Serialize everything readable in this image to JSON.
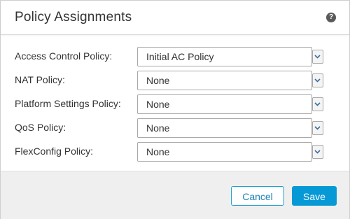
{
  "dialog": {
    "title": "Policy Assignments",
    "help_icon": "question-circle-icon",
    "help_glyph": "?"
  },
  "policies": [
    {
      "label": "Access Control Policy:",
      "value": "Initial AC Policy"
    },
    {
      "label": "NAT Policy:",
      "value": "None"
    },
    {
      "label": "Platform Settings Policy:",
      "value": "None"
    },
    {
      "label": "QoS Policy:",
      "value": "None"
    },
    {
      "label": "FlexConfig Policy:",
      "value": "None"
    }
  ],
  "footer": {
    "cancel_label": "Cancel",
    "save_label": "Save"
  },
  "colors": {
    "accent": "#0799d6",
    "cancel_text": "#1c7fb8",
    "footer_bg": "#efefef"
  }
}
